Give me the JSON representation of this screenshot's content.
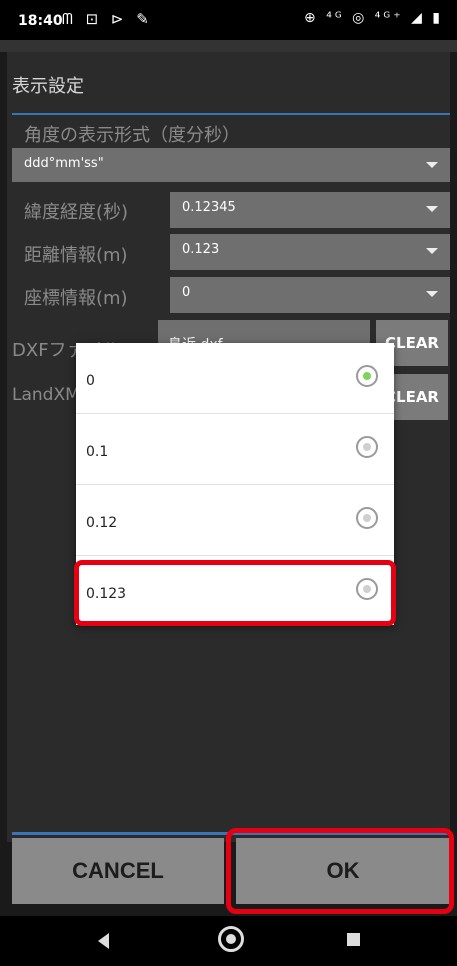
{
  "status_bar": {
    "time": "18:40",
    "left_icons": "ᗰ ⊡ ⊳ ✎",
    "right_icons": "⊕ ⁴ᴳ ◎ ⁴ᴳ⁺ ◢ ▮"
  },
  "dialog": {
    "title": "表示設定",
    "angle_format_label": "角度の表示形式（度分秒）",
    "angle_format_value": "ddd°mm'ss\"",
    "rows": [
      {
        "label": "緯度経度(秒)",
        "value": "0.12345"
      },
      {
        "label": "距離情報(m)",
        "value": "0.123"
      },
      {
        "label": "座標情報(m)",
        "value": "0"
      }
    ],
    "dxf": {
      "label": "DXFファイル",
      "value": "鳥近.dxf",
      "clear_label": "CLEAR"
    },
    "landxml": {
      "label": "LandXML",
      "clear_label": "CLEAR"
    }
  },
  "popup": {
    "options": [
      {
        "label": "0",
        "selected": true
      },
      {
        "label": "0.1",
        "selected": false
      },
      {
        "label": "0.12",
        "selected": false
      },
      {
        "label": "0.123",
        "selected": false
      }
    ]
  },
  "buttons": {
    "cancel": "CANCEL",
    "ok": "OK"
  },
  "colors": {
    "accent": "#3a73b8",
    "highlight": "#e60012",
    "radio_checked": "#7fd25a"
  }
}
